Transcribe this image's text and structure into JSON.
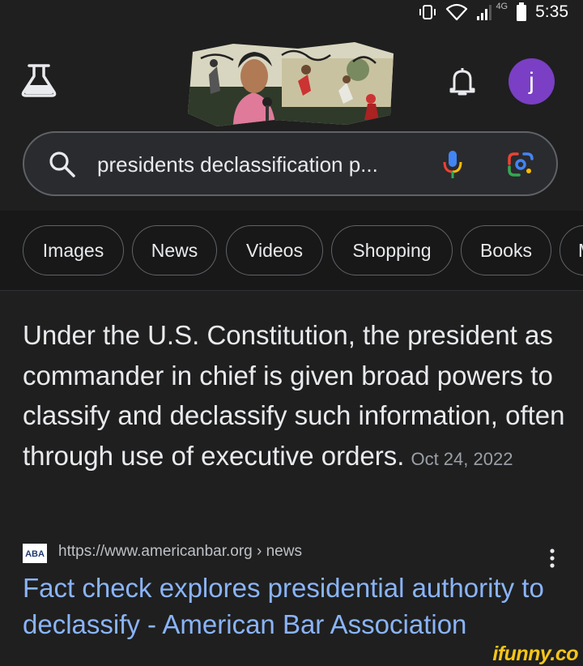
{
  "status_bar": {
    "network": "4G",
    "time": "5:35"
  },
  "header": {
    "avatar_letter": "j"
  },
  "search": {
    "query": "presidents declassification p..."
  },
  "chips": [
    "Images",
    "News",
    "Videos",
    "Shopping",
    "Books",
    "M"
  ],
  "answer": {
    "text": "Under the U.S. Constitution, the president as commander in chief is given broad powers to classify and declassify such information, often through use of executive orders.",
    "date": "Oct 24, 2022"
  },
  "result": {
    "favicon_text": "ABA",
    "url": "https://www.americanbar.org › news",
    "title": "Fact check explores presidential authority to declassify - American Bar Association"
  },
  "watermark": "ifunny.co",
  "colors": {
    "background": "#1f1f1f",
    "chip_row_background": "#181818",
    "link": "#8ab4f8",
    "avatar": "#7a3fc4",
    "watermark": "#f5c518"
  },
  "icons": [
    "vibrate-icon",
    "wifi-icon",
    "signal-icon",
    "battery-icon",
    "labs-flask-icon",
    "bell-icon",
    "search-icon",
    "mic-icon",
    "lens-icon",
    "more-vert-icon"
  ]
}
